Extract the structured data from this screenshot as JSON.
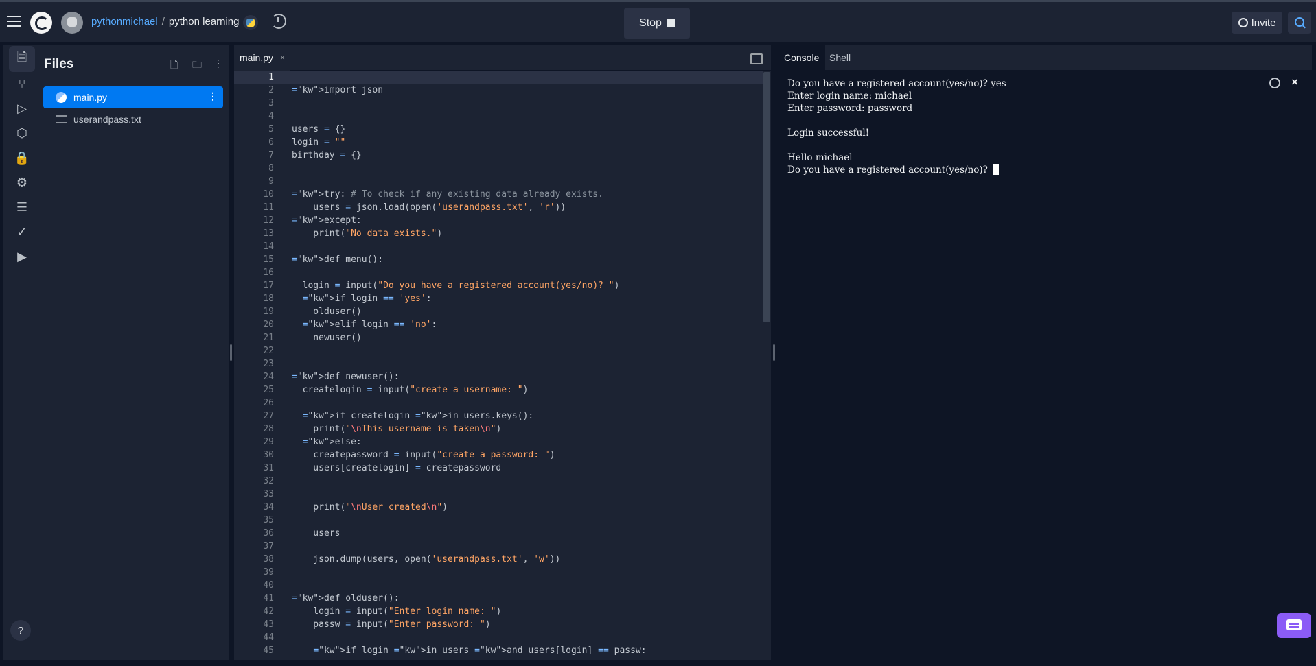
{
  "header": {
    "username": "pythonmichael",
    "separator": "/",
    "project": "python learning",
    "run_button": "Stop",
    "invite_button": "Invite"
  },
  "rail": {
    "icons": [
      "files-icon",
      "git-icon",
      "run-icon",
      "packages-icon",
      "secrets-icon",
      "settings-icon",
      "database-icon",
      "tests-icon",
      "video-icon"
    ],
    "help": "?"
  },
  "files": {
    "title": "Files",
    "items": [
      {
        "name": "main.py"
      },
      {
        "name": "userandpass.txt"
      }
    ]
  },
  "editor": {
    "tab": "main.py",
    "close": "×"
  },
  "code_lines": [
    "",
    "import json",
    "",
    "",
    "users = {}",
    "login = \"\"",
    "birthday = {}",
    "",
    "",
    "try: # To check if any existing data already exists.",
    "    users = json.load(open('userandpass.txt', 'r'))",
    "except:",
    "    print(\"No data exists.\")",
    "",
    "def menu():",
    "",
    "  login = input(\"Do you have a registered account(yes/no)? \")",
    "  if login == 'yes':",
    "    olduser()",
    "  elif login == 'no':",
    "    newuser()",
    "",
    "",
    "def newuser():",
    "  createlogin = input(\"create a username: \")",
    "",
    "  if createlogin in users.keys():",
    "    print(\"\\nThis username is taken\\n\")",
    "  else:",
    "    createpassword = input(\"create a password: \")",
    "    users[createlogin] = createpassword",
    "",
    "",
    "    print(\"\\nUser created\\n\")",
    "",
    "    users",
    "",
    "    json.dump(users, open('userandpass.txt', 'w'))",
    "",
    "",
    "def olduser():",
    "    login = input(\"Enter login name: \")",
    "    passw = input(\"Enter password: \")",
    "",
    "    if login in users and users[login] == passw:"
  ],
  "console": {
    "tabs": [
      "Console",
      "Shell"
    ],
    "output": "Do you have a registered account(yes/no)? yes\nEnter login name: michael\nEnter password: password\n\nLogin successful!\n\nHello michael\nDo you have a registered account(yes/no)? ",
    "close": "×"
  }
}
